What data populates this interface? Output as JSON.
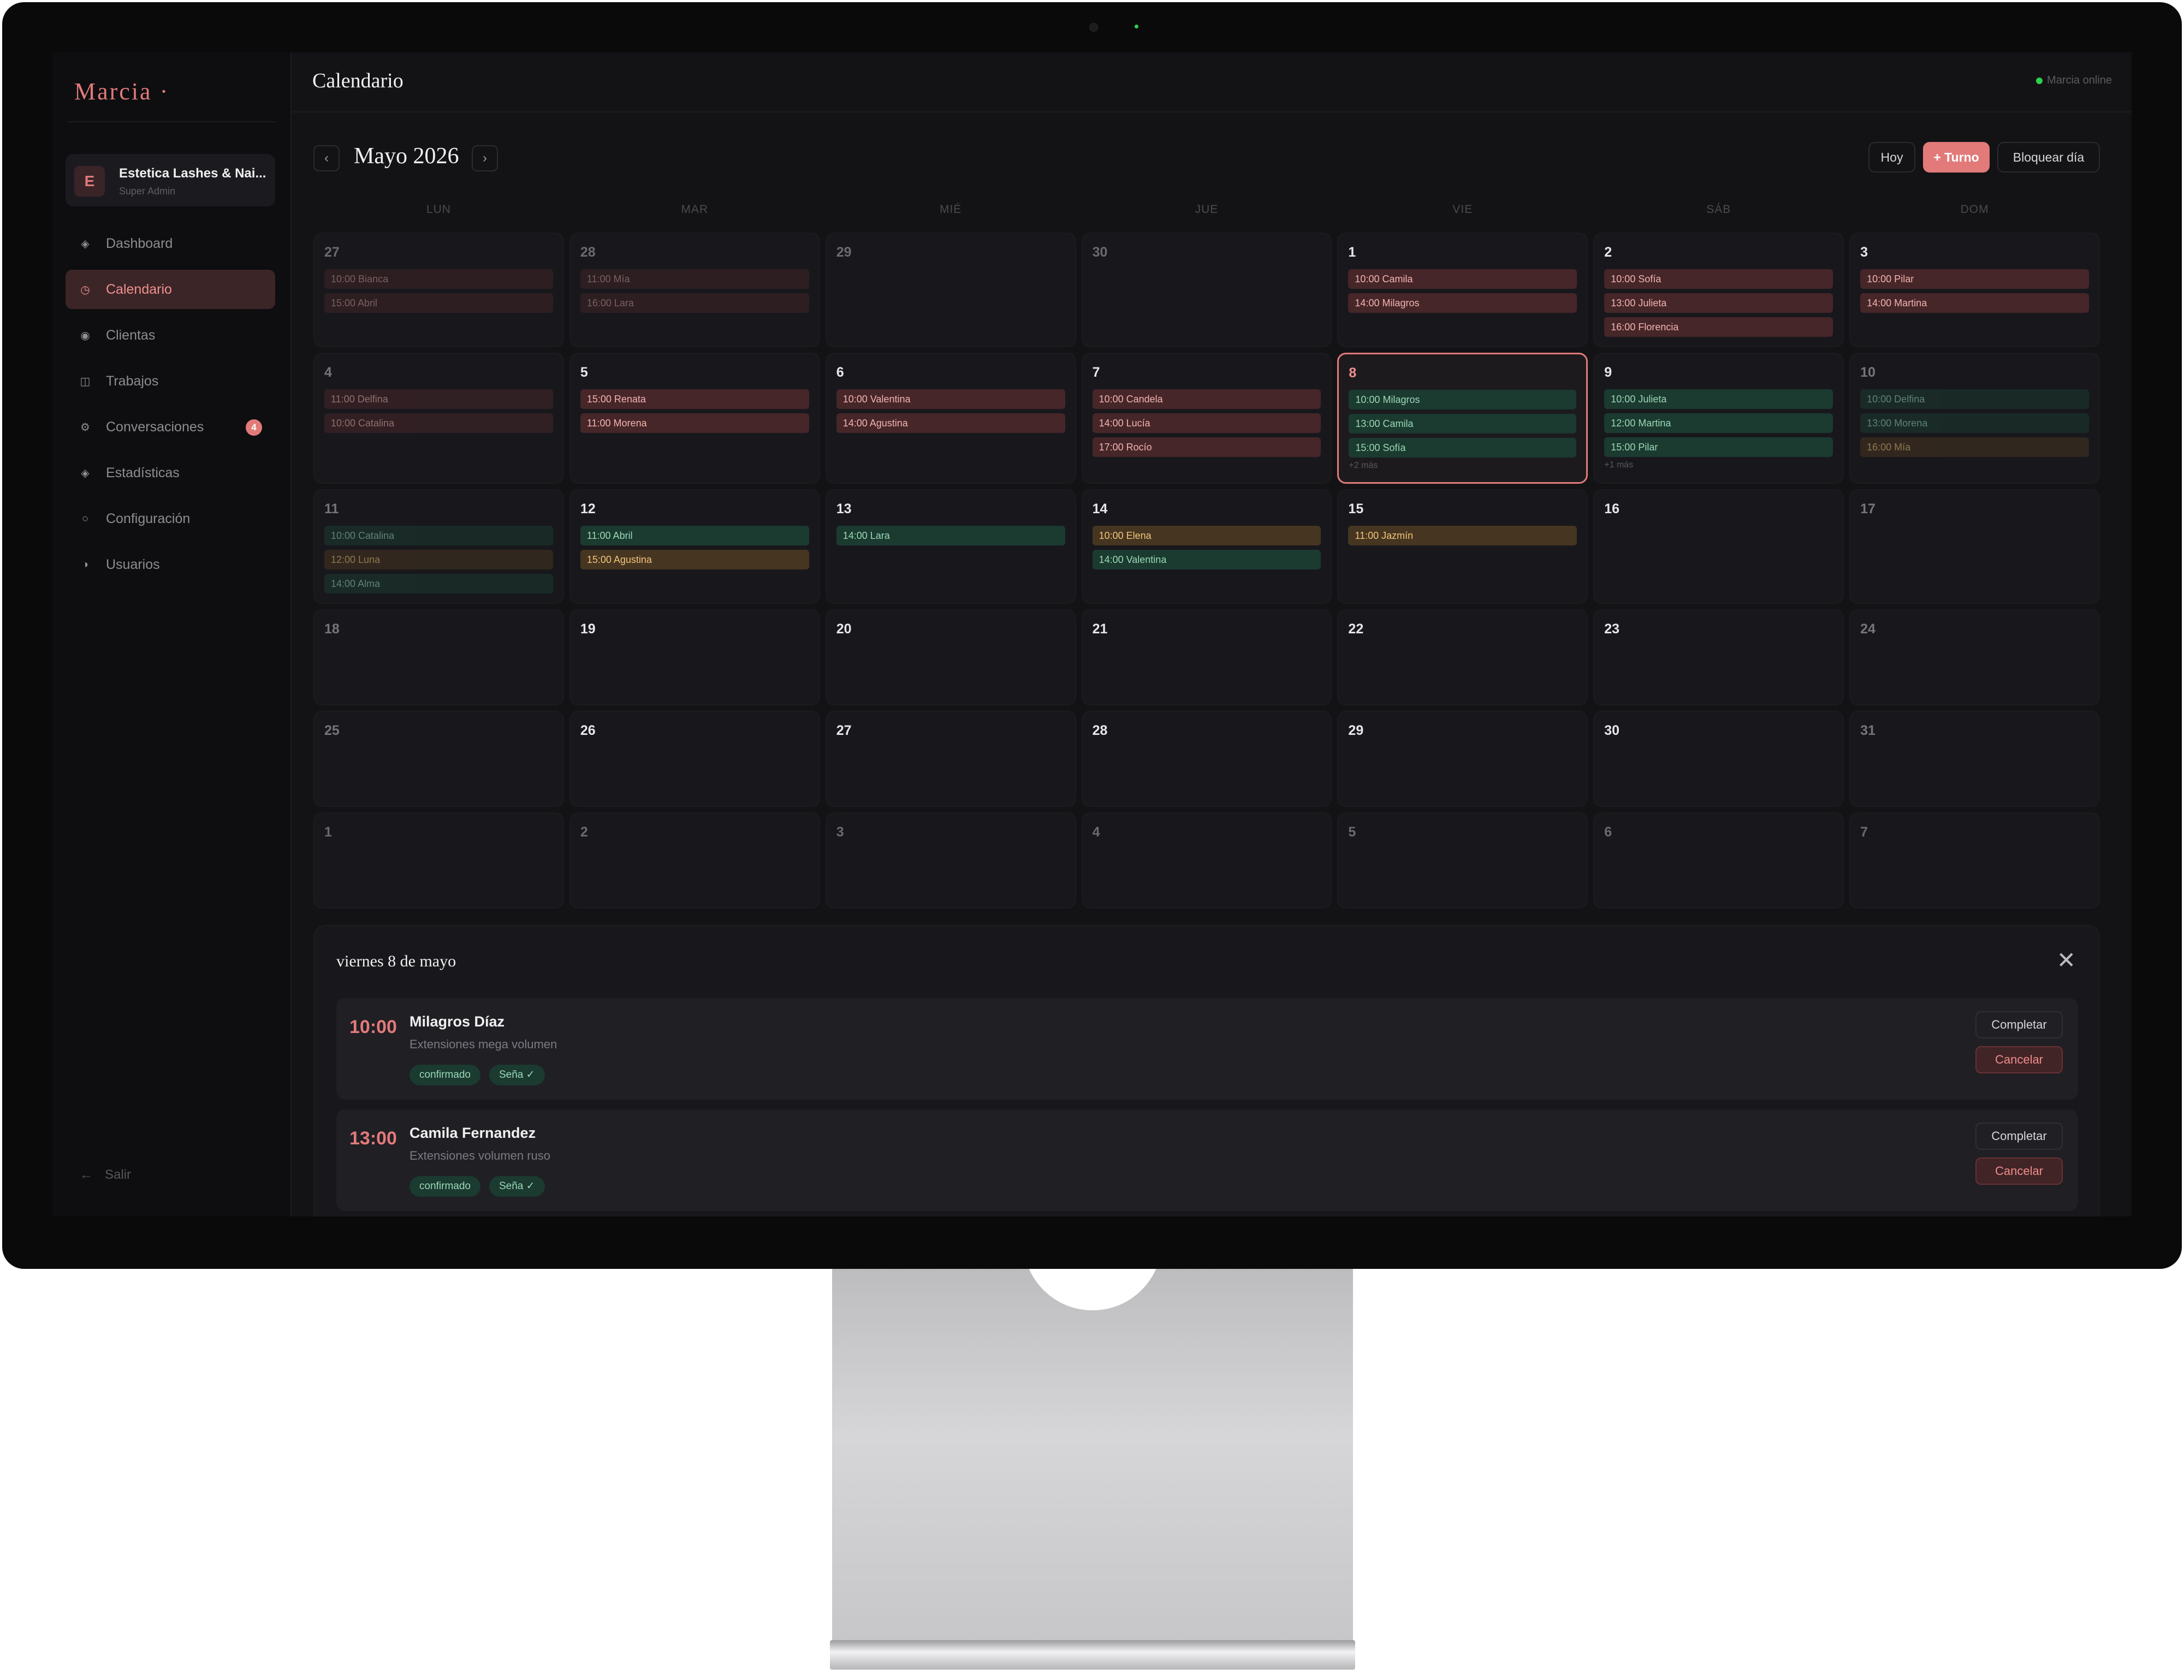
{
  "sidebar": {
    "logo": "Marcia ·",
    "org": {
      "avatar": "E",
      "name": "Estetica Lashes & Nai...",
      "role": "Super Admin"
    },
    "items": [
      {
        "label": "Dashboard",
        "icon": "◈"
      },
      {
        "label": "Calendario",
        "icon": "◷"
      },
      {
        "label": "Clientas",
        "icon": "◉"
      },
      {
        "label": "Trabajos",
        "icon": "◫"
      },
      {
        "label": "Conversaciones",
        "icon": "⚙",
        "badge": "4"
      },
      {
        "label": "Estadísticas",
        "icon": "◈"
      },
      {
        "label": "Configuración",
        "icon": "○"
      },
      {
        "label": "Usuarios",
        "icon": "◑"
      }
    ],
    "logout": {
      "icon": "←",
      "label": "Salir"
    }
  },
  "header": {
    "title": "Calendario",
    "status": "Marcia online"
  },
  "calendar": {
    "month": "Mayo 2026",
    "prev": "‹",
    "next": "›",
    "buttons": {
      "today": "Hoy",
      "new": "+ Turno",
      "block": "Bloquear día"
    },
    "weekdays": [
      "LUN",
      "MAR",
      "MIÉ",
      "JUE",
      "VIE",
      "SÁB",
      "DOM"
    ],
    "weeks": [
      [
        {
          "day": "27",
          "outside": true,
          "events": [
            {
              "text": "10:00 Bianca",
              "color": "red"
            },
            {
              "text": "15:00 Abril",
              "color": "red"
            }
          ]
        },
        {
          "day": "28",
          "outside": true,
          "events": [
            {
              "text": "11:00 Mía",
              "color": "red"
            },
            {
              "text": "16:00 Lara",
              "color": "red"
            }
          ]
        },
        {
          "day": "29",
          "outside": true,
          "events": []
        },
        {
          "day": "30",
          "outside": true,
          "events": []
        },
        {
          "day": "1",
          "events": [
            {
              "text": "10:00 Camila",
              "color": "red"
            },
            {
              "text": "14:00 Milagros",
              "color": "red"
            }
          ]
        },
        {
          "day": "2",
          "events": [
            {
              "text": "10:00 Sofía",
              "color": "red"
            },
            {
              "text": "13:00 Julieta",
              "color": "red"
            },
            {
              "text": "16:00 Florencia",
              "color": "red"
            }
          ]
        },
        {
          "day": "3",
          "events": [
            {
              "text": "10:00 Pilar",
              "color": "red"
            },
            {
              "text": "14:00 Martina",
              "color": "red"
            }
          ]
        }
      ],
      [
        {
          "day": "4",
          "events": [
            {
              "text": "11:00 Delfina",
              "color": "red"
            },
            {
              "text": "10:00 Catalina",
              "color": "red"
            }
          ],
          "dim": true
        },
        {
          "day": "5",
          "events": [
            {
              "text": "15:00 Renata",
              "color": "red"
            },
            {
              "text": "11:00 Morena",
              "color": "red"
            }
          ]
        },
        {
          "day": "6",
          "events": [
            {
              "text": "10:00 Valentina",
              "color": "red"
            },
            {
              "text": "14:00 Agustina",
              "color": "red"
            }
          ]
        },
        {
          "day": "7",
          "events": [
            {
              "text": "10:00 Candela",
              "color": "red"
            },
            {
              "text": "14:00 Lucía",
              "color": "red"
            },
            {
              "text": "17:00 Rocío",
              "color": "red"
            }
          ]
        },
        {
          "day": "8",
          "selected": true,
          "events": [
            {
              "text": "10:00 Milagros",
              "color": "green"
            },
            {
              "text": "13:00 Camila",
              "color": "green"
            },
            {
              "text": "15:00 Sofía",
              "color": "green"
            }
          ],
          "more": "+2 más"
        },
        {
          "day": "9",
          "events": [
            {
              "text": "10:00 Julieta",
              "color": "green"
            },
            {
              "text": "12:00 Martina",
              "color": "green"
            },
            {
              "text": "15:00 Pilar",
              "color": "green"
            }
          ],
          "more": "+1 más"
        },
        {
          "day": "10",
          "events": [
            {
              "text": "10:00 Delfina",
              "color": "green"
            },
            {
              "text": "13:00 Morena",
              "color": "green"
            },
            {
              "text": "16:00 Mía",
              "color": "amber"
            }
          ],
          "dim": true
        }
      ],
      [
        {
          "day": "11",
          "events": [
            {
              "text": "10:00 Catalina",
              "color": "green"
            },
            {
              "text": "12:00 Luna",
              "color": "amber"
            },
            {
              "text": "14:00 Alma",
              "color": "green"
            }
          ],
          "dim": true
        },
        {
          "day": "12",
          "events": [
            {
              "text": "11:00 Abril",
              "color": "green"
            },
            {
              "text": "15:00 Agustina",
              "color": "amber"
            }
          ]
        },
        {
          "day": "13",
          "events": [
            {
              "text": "14:00 Lara",
              "color": "green"
            }
          ]
        },
        {
          "day": "14",
          "events": [
            {
              "text": "10:00 Elena",
              "color": "amber"
            },
            {
              "text": "14:00 Valentina",
              "color": "green"
            }
          ]
        },
        {
          "day": "15",
          "events": [
            {
              "text": "11:00 Jazmín",
              "color": "amber"
            }
          ]
        },
        {
          "day": "16",
          "events": []
        },
        {
          "day": "17",
          "events": [],
          "dim": true
        }
      ],
      [
        {
          "day": "18",
          "events": [],
          "dim": true
        },
        {
          "day": "19",
          "events": []
        },
        {
          "day": "20",
          "events": []
        },
        {
          "day": "21",
          "events": []
        },
        {
          "day": "22",
          "events": []
        },
        {
          "day": "23",
          "events": []
        },
        {
          "day": "24",
          "events": [],
          "dim": true
        }
      ],
      [
        {
          "day": "25",
          "events": [],
          "dim": true
        },
        {
          "day": "26",
          "events": []
        },
        {
          "day": "27",
          "events": []
        },
        {
          "day": "28",
          "events": []
        },
        {
          "day": "29",
          "events": []
        },
        {
          "day": "30",
          "events": []
        },
        {
          "day": "31",
          "events": [],
          "dim": true
        }
      ],
      [
        {
          "day": "1",
          "outside": true,
          "events": []
        },
        {
          "day": "2",
          "outside": true,
          "events": []
        },
        {
          "day": "3",
          "outside": true,
          "events": []
        },
        {
          "day": "4",
          "outside": true,
          "events": []
        },
        {
          "day": "5",
          "outside": true,
          "events": []
        },
        {
          "day": "6",
          "outside": true,
          "events": []
        },
        {
          "day": "7",
          "outside": true,
          "events": []
        }
      ]
    ]
  },
  "detail": {
    "title": "viernes 8 de mayo",
    "close_icon": "✕",
    "appointments": [
      {
        "time": "10:00",
        "name": "Milagros Díaz",
        "service": "Extensiones mega volumen",
        "tags": [
          "confirmado",
          "Seña ✓"
        ],
        "complete": "Completar",
        "cancel": "Cancelar"
      },
      {
        "time": "13:00",
        "name": "Camila Fernandez",
        "service": "Extensiones volumen ruso",
        "tags": [
          "confirmado",
          "Seña ✓"
        ],
        "complete": "Completar",
        "cancel": "Cancelar"
      }
    ]
  }
}
